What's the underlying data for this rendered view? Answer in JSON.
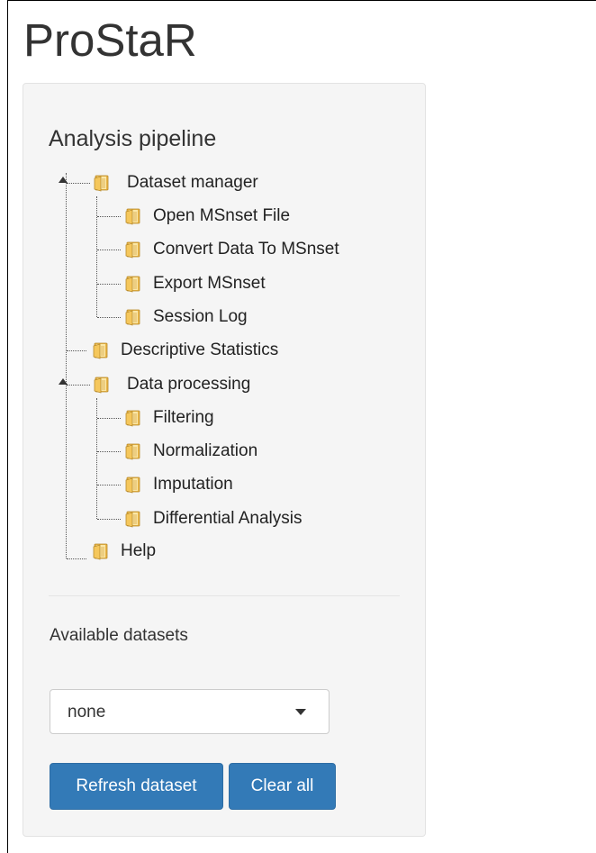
{
  "app": {
    "title": "ProStaR"
  },
  "sidebar": {
    "section_title": "Analysis pipeline",
    "tree": [
      {
        "label": "Dataset manager",
        "icon": "folder-icon",
        "expanded": true,
        "children": [
          {
            "label": "Open MSnset File",
            "icon": "folder-icon"
          },
          {
            "label": "Convert Data To MSnset",
            "icon": "folder-icon"
          },
          {
            "label": "Export MSnset",
            "icon": "folder-icon"
          },
          {
            "label": "Session Log",
            "icon": "folder-icon"
          }
        ]
      },
      {
        "label": "Descriptive Statistics",
        "icon": "folder-icon",
        "expanded": false,
        "children": []
      },
      {
        "label": "Data processing",
        "icon": "folder-icon",
        "expanded": true,
        "children": [
          {
            "label": "Filtering",
            "icon": "folder-icon"
          },
          {
            "label": "Normalization",
            "icon": "folder-icon"
          },
          {
            "label": "Imputation",
            "icon": "folder-icon"
          },
          {
            "label": "Differential Analysis",
            "icon": "folder-icon"
          }
        ]
      },
      {
        "label": "Help",
        "icon": "folder-icon",
        "expanded": false,
        "children": []
      }
    ],
    "datasets": {
      "label": "Available datasets",
      "selected": "none"
    },
    "buttons": {
      "refresh_label": "Refresh dataset",
      "clear_label": "Clear all"
    }
  },
  "colors": {
    "panel_bg": "#f5f5f5",
    "button_primary": "#337ab7",
    "folder_yellow": "#f3c760",
    "text": "#333333"
  }
}
